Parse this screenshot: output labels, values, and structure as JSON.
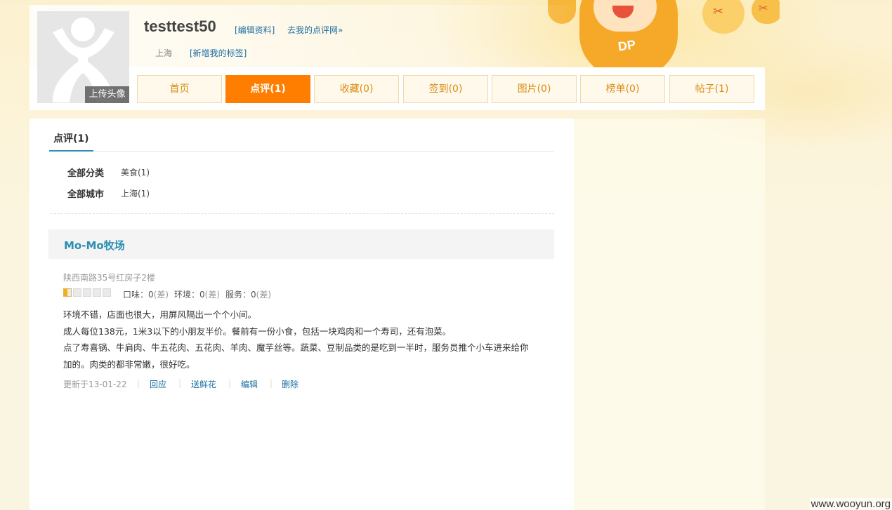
{
  "profile": {
    "username": "testtest50",
    "edit_link": "[编辑资料]",
    "dianping_link": "去我的点评网»",
    "city": "上海",
    "tag_link": "[新增我的标签]",
    "upload_avatar": "上传头像"
  },
  "tabs": [
    {
      "label": "首页",
      "active": false
    },
    {
      "label": "点评(1)",
      "active": true
    },
    {
      "label": "收藏(0)",
      "active": false
    },
    {
      "label": "签到(0)",
      "active": false
    },
    {
      "label": "图片(0)",
      "active": false
    },
    {
      "label": "榜单(0)",
      "active": false
    },
    {
      "label": "帖子(1)",
      "active": false
    }
  ],
  "subtab": "点评(1)",
  "filters": {
    "category_label": "全部分类",
    "category_value": "美食(1)",
    "city_label": "全部城市",
    "city_value": "上海(1)"
  },
  "review": {
    "shop_name": "Mo-Mo牧场",
    "address": "陕西南路35号红房子2楼",
    "rating_stars": 0.5,
    "scores": {
      "taste_label": "口味：",
      "taste_value": "0",
      "taste_note": "(差)",
      "env_label": "环境：",
      "env_value": "0",
      "env_note": "(差)",
      "service_label": "服务：",
      "service_value": "0",
      "service_note": "(差)"
    },
    "text": [
      "环境不错，店面也很大，用屏风隔出一个个小间。",
      "成人每位138元，1米3以下的小朋友半价。餐前有一份小食，包括一块鸡肉和一个寿司，还有泡菜。",
      "点了寿喜锅、牛肩肉、牛五花肉、五花肉、羊肉、魔芋丝等。蔬菜、豆制品类的是吃到一半时，服务员推个小车进来给你",
      "加的。肉类的都非常嫩，很好吃。"
    ],
    "updated": "更新于13-01-22",
    "actions": {
      "reply": "回应",
      "flower": "送鲜花",
      "edit": "编辑",
      "delete": "删除"
    }
  },
  "watermark": "www.wooyun.org",
  "colors": {
    "accent_orange": "#ff7e00",
    "link_blue": "#1d6fa3",
    "shop_blue": "#2b8fb0"
  }
}
